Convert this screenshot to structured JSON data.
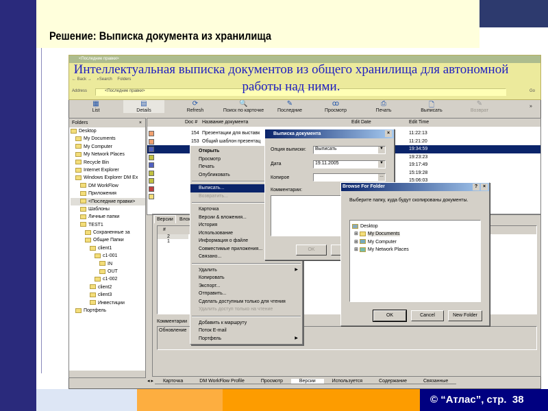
{
  "slide": {
    "title": "Решение: Выписка документа из хранилища",
    "callout": "Интеллектуальная выписка документов из общего хранилища для автономной работы над ними.",
    "footer": "© “Атлас”, стр.  38"
  },
  "window": {
    "title": "<Последние правки>",
    "nav": {
      "back": "Back",
      "search": "Search",
      "folders": "Folders"
    },
    "address_label": "Address",
    "address_value": "<Последние правки>",
    "go": "Go"
  },
  "toolbar": [
    "List",
    "Details",
    "Refresh",
    "Поиск по карточке",
    "Последние",
    "Просмотр",
    "Печать",
    "Выписать",
    "Возврат",
    "»"
  ],
  "folders": {
    "header": "Folders",
    "close": "×",
    "items": [
      "Desktop",
      "My Documents",
      "My Computer",
      "My Network Places",
      "Recycle Bin",
      "Internet Explorer",
      "Windows Explorer DM Ex",
      "DM WorkFlow",
      "Приложения",
      "<Последние правки>",
      "Шаблоны",
      "Личные папки",
      "TEST1",
      "Сохраненные за",
      "Общие Папки",
      "client1",
      "c1-001",
      "IN",
      "OUT",
      "c1-002",
      "client2",
      "client3",
      "Инвестиции",
      "Портфель"
    ]
  },
  "doclist": {
    "columns": [
      "Doc #",
      "Название документа",
      "Edit Date",
      "Edit Time"
    ],
    "rows": [
      {
        "num": "154",
        "name": "Презентации для выставк",
        "time": "11:22:13"
      },
      {
        "num": "153",
        "name": "Общий шаблон презентац",
        "time": "11:21:20"
      },
      {
        "num": "",
        "name": "",
        "time": "19:34:59"
      },
      {
        "num": "",
        "name": "",
        "time": "19:23:23"
      },
      {
        "num": "",
        "name": "",
        "time": "19:17:49"
      },
      {
        "num": "",
        "name": "",
        "time": "15:19:28"
      },
      {
        "num": "",
        "name": "",
        "time": "15:06:03"
      }
    ]
  },
  "lower": {
    "tabs": [
      "Версии",
      "Влож"
    ],
    "col": "#",
    "rows": [
      "2",
      "1"
    ],
    "comments_label": "Комментарии",
    "comment": "Обновление"
  },
  "context_menu": {
    "groups": [
      [
        "Открыть",
        "Просмотр",
        "Печать",
        "Опубликовать"
      ],
      [
        "Выписать...",
        "Возвратить..."
      ],
      [
        "Карточка",
        "Версии & вложения...",
        "История",
        "Использование",
        "Информация о файле",
        "Совместимые приложения...",
        "Связано..."
      ],
      [
        "Удалить",
        "Копировать",
        "Экспорт...",
        "Отправить...",
        "Сделать доступным только для чтения",
        "Удалить доступ только на чтение"
      ],
      [
        "Добавить к маршруту",
        "Поток E-mail",
        "Портфель"
      ]
    ]
  },
  "checkout_dialog": {
    "title": "Выписка документа",
    "option_label": "Опция выписки:",
    "option_value": "Выписать",
    "date_label": "Дата",
    "date_value": "19.11.2005",
    "copy_label": "Копирое",
    "comments_label": "Комментарии:",
    "ok": "OK",
    "cancel": "C"
  },
  "browse_dialog": {
    "title": "Browse For Folder",
    "help": "?",
    "close": "×",
    "prompt": "Выберите папку, куда будут скопированы документы.",
    "items": [
      "Desktop",
      "My Documents",
      "My Computer",
      "My Network Places"
    ],
    "ok": "OK",
    "cancel": "Cancel",
    "new_folder": "New Folder"
  },
  "bottom_tabs": [
    "Карточка",
    "DM WorkFlow Profile",
    "Просмотр",
    "Версии",
    "Используется",
    "Содержание",
    "Связанные"
  ],
  "colors": {
    "navy": "#2a2a7c",
    "cream": "#ffffdc",
    "orange": "#fd9c00",
    "light_orange": "#fdae40",
    "selection": "#0a246a"
  }
}
